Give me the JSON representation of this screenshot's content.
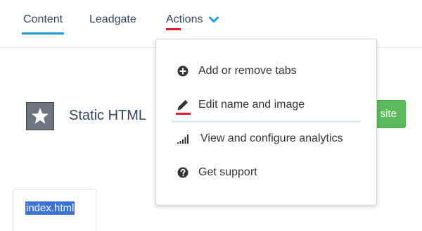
{
  "tabs": {
    "content": "Content",
    "leadgate": "Leadgate",
    "actions": "Actions"
  },
  "page": {
    "title": "Static HTML",
    "visit_button": "site",
    "file_tab": "index.html"
  },
  "actions_menu": {
    "items": [
      {
        "label": "Add or remove tabs",
        "icon": "plus-circle-icon"
      },
      {
        "label": "Edit name and image",
        "icon": "pencil-icon"
      },
      {
        "label": "View and configure analytics",
        "icon": "signal-bars-icon"
      },
      {
        "label": "Get support",
        "icon": "question-circle-icon"
      }
    ]
  },
  "colors": {
    "active_tab_underline": "#1a9bd7",
    "annotation_red": "#e8192c",
    "button_green": "#5cb85c",
    "selection_blue": "#3b73d6"
  }
}
